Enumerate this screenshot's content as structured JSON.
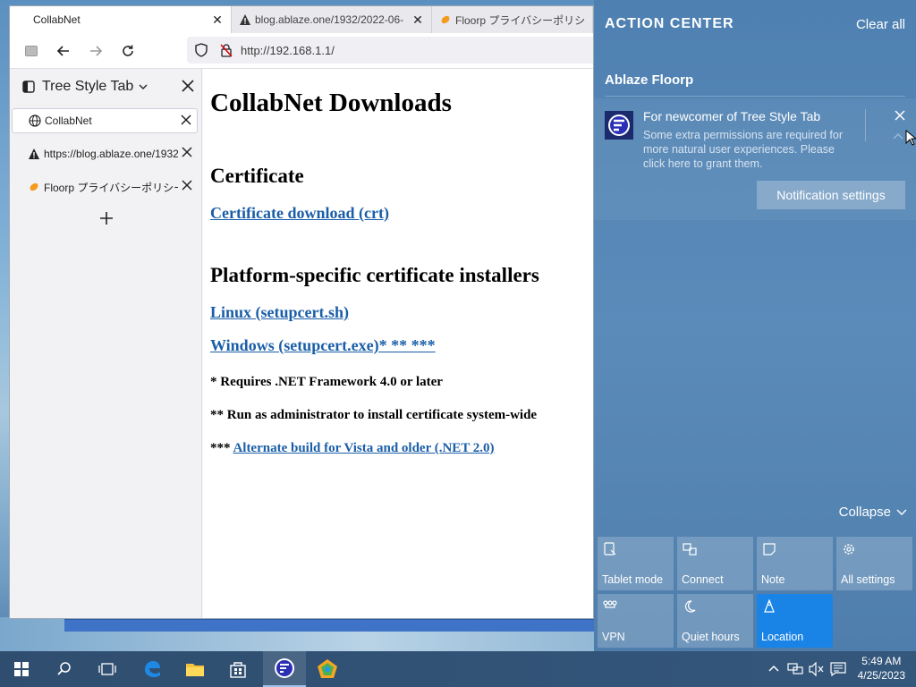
{
  "browser": {
    "tabs": [
      {
        "label": "CollabNet",
        "active": true
      },
      {
        "label": "blog.ablaze.one/1932/2022-06-…",
        "active": false
      },
      {
        "label": "Floorp プライバシーポリシ",
        "active": false
      }
    ],
    "url": "http://192.168.1.1/"
  },
  "sidebar": {
    "title": "Tree Style Tab",
    "tabs": [
      {
        "label": "CollabNet"
      },
      {
        "label": "https://blog.ablaze.one/1932"
      },
      {
        "label": "Floorp プライバシーポリシー"
      }
    ]
  },
  "page": {
    "title": "CollabNet Downloads",
    "cert_heading": "Certificate",
    "cert_link": "Certificate download (crt)",
    "platform_heading": "Platform-specific certificate installers",
    "linux_link": "Linux (setupcert.sh)",
    "windows_link": "Windows (setupcert.exe)* ** ***",
    "note1": "* Requires .NET Framework 4.0 or later",
    "note2": "** Run as administrator to install certificate system-wide",
    "note3_prefix": "*** ",
    "note3_link": "Alternate build for Vista and older (.NET 2.0)"
  },
  "action_center": {
    "title": "ACTION CENTER",
    "clear_all": "Clear all",
    "app_name": "Ablaze Floorp",
    "notification": {
      "title": "For newcomer of Tree Style Tab",
      "body": "Some extra permissions are required for more natural user experiences. Please click here to grant them.",
      "settings_button": "Notification settings"
    },
    "collapse": "Collapse",
    "quick_actions": [
      {
        "label": "Tablet mode",
        "icon": "tablet-icon",
        "active": false
      },
      {
        "label": "Connect",
        "icon": "connect-icon",
        "active": false
      },
      {
        "label": "Note",
        "icon": "note-icon",
        "active": false
      },
      {
        "label": "All settings",
        "icon": "gear-icon",
        "active": false
      },
      {
        "label": "VPN",
        "icon": "vpn-icon",
        "active": false
      },
      {
        "label": "Quiet hours",
        "icon": "moon-icon",
        "active": false
      },
      {
        "label": "Location",
        "icon": "location-icon",
        "active": true
      }
    ]
  },
  "taskbar": {
    "time": "5:49 AM",
    "date": "4/25/2023"
  },
  "colors": {
    "link": "#1a5ea8",
    "action_center_bg": "#4e80b1",
    "quick_action_active": "#1a84e6",
    "taskbar": "#2f4e6f"
  }
}
